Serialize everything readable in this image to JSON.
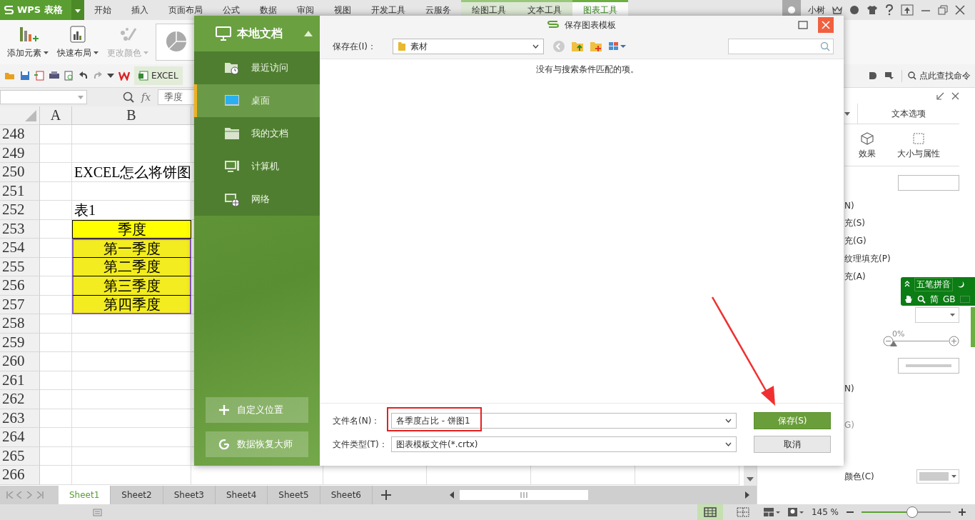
{
  "app": {
    "logo": "WPS 表格",
    "user": "小树",
    "menu_tabs": [
      {
        "label": "开始",
        "kind": "main",
        "selected": false
      },
      {
        "label": "插入",
        "kind": "main",
        "selected": false
      },
      {
        "label": "页面布局",
        "kind": "main",
        "selected": false
      },
      {
        "label": "公式",
        "kind": "main",
        "selected": false
      },
      {
        "label": "数据",
        "kind": "main",
        "selected": false
      },
      {
        "label": "审阅",
        "kind": "main",
        "selected": false
      },
      {
        "label": "视图",
        "kind": "main",
        "selected": false
      },
      {
        "label": "开发工具",
        "kind": "main",
        "selected": false
      },
      {
        "label": "云服务",
        "kind": "main",
        "selected": false
      },
      {
        "label": "绘图工具",
        "kind": "context",
        "selected": false
      },
      {
        "label": "文本工具",
        "kind": "context",
        "selected": false
      },
      {
        "label": "图表工具",
        "kind": "context",
        "selected": true
      }
    ]
  },
  "ribbon": {
    "buttons": [
      {
        "label": "添加元素",
        "disabled": false
      },
      {
        "label": "快速布局",
        "disabled": false
      },
      {
        "label": "更改颜色",
        "disabled": true
      }
    ]
  },
  "toolbar": {
    "document_tab": "EXCEL",
    "command_search": "点此查找命令"
  },
  "formula_bar": {
    "function_label": "fx",
    "content": "季度"
  },
  "sheet": {
    "columns": [
      "A",
      "B"
    ],
    "rows": [
      {
        "number": "248",
        "cell_b": "",
        "kind": "plain",
        "selected": false
      },
      {
        "number": "249",
        "cell_b": "",
        "kind": "plain",
        "selected": false
      },
      {
        "number": "250",
        "cell_b": "EXCEL怎么将饼图",
        "kind": "title",
        "selected": false
      },
      {
        "number": "251",
        "cell_b": "",
        "kind": "plain",
        "selected": false
      },
      {
        "number": "252",
        "cell_b": "表1",
        "kind": "caption",
        "selected": false
      },
      {
        "number": "253",
        "cell_b": "季度",
        "kind": "header",
        "selected": false
      },
      {
        "number": "254",
        "cell_b": "第一季度",
        "kind": "data",
        "selected": true
      },
      {
        "number": "255",
        "cell_b": "第二季度",
        "kind": "data",
        "selected": true
      },
      {
        "number": "256",
        "cell_b": "第三季度",
        "kind": "data",
        "selected": true
      },
      {
        "number": "257",
        "cell_b": "第四季度",
        "kind": "data",
        "selected": true
      },
      {
        "number": "258",
        "cell_b": "",
        "kind": "plain",
        "selected": false
      },
      {
        "number": "259",
        "cell_b": "",
        "kind": "plain",
        "selected": false
      },
      {
        "number": "260",
        "cell_b": "",
        "kind": "plain",
        "selected": false
      },
      {
        "number": "261",
        "cell_b": "",
        "kind": "plain",
        "selected": false
      },
      {
        "number": "262",
        "cell_b": "",
        "kind": "plain",
        "selected": false
      },
      {
        "number": "263",
        "cell_b": "",
        "kind": "plain",
        "selected": false
      },
      {
        "number": "264",
        "cell_b": "",
        "kind": "plain",
        "selected": false
      },
      {
        "number": "265",
        "cell_b": "",
        "kind": "plain",
        "selected": false
      },
      {
        "number": "266",
        "cell_b": "",
        "kind": "plain",
        "selected": false
      }
    ]
  },
  "sheet_tabs": [
    {
      "label": "Sheet1",
      "selected": true
    },
    {
      "label": "Sheet2",
      "selected": false
    },
    {
      "label": "Sheet3",
      "selected": false
    },
    {
      "label": "Sheet4",
      "selected": false
    },
    {
      "label": "Sheet5",
      "selected": false
    },
    {
      "label": "Sheet6",
      "selected": false
    }
  ],
  "format_panel": {
    "tab": "文本选项",
    "categories": [
      "效果",
      "大小与属性"
    ],
    "options": [
      "N)",
      "充(S)",
      "充(G)",
      "纹理填充(P)",
      "充(A)"
    ],
    "transparency": {
      "reading": "0%",
      "level": 0
    },
    "option_2": "N)",
    "option_3": "G)",
    "color_label": "颜色(C)"
  },
  "ime_toolbar": {
    "name": "五笔拼音",
    "mode": "简",
    "charset": "GB"
  },
  "status_bar": {
    "zoom": {
      "reading": "145 %",
      "level": 0.57
    }
  },
  "dialog": {
    "title": "保存图表模板",
    "sidebar_title": "本地文档",
    "places": [
      {
        "label": "最近访问",
        "kind": "recent",
        "selected": false
      },
      {
        "label": "桌面",
        "kind": "desktop",
        "selected": true
      },
      {
        "label": "我的文档",
        "kind": "documents",
        "selected": false
      },
      {
        "label": "计算机",
        "kind": "computer",
        "selected": false
      },
      {
        "label": "网络",
        "kind": "network",
        "selected": false
      }
    ],
    "side_buttons": [
      {
        "label": "自定义位置",
        "kind": "custom"
      },
      {
        "label": "数据恢复大师",
        "kind": "recovery"
      }
    ],
    "save_in_label": "保存在(I)：",
    "save_in": "素材",
    "empty_message": "没有与搜索条件匹配的项。",
    "file_name_label": "文件名(N)：",
    "file_name": "各季度占比 - 饼图1",
    "file_type_label": "文件类型(T)：",
    "file_type": "图表模板文件(*.crtx)",
    "save_button": "保存(S)",
    "cancel_button": "取消"
  }
}
